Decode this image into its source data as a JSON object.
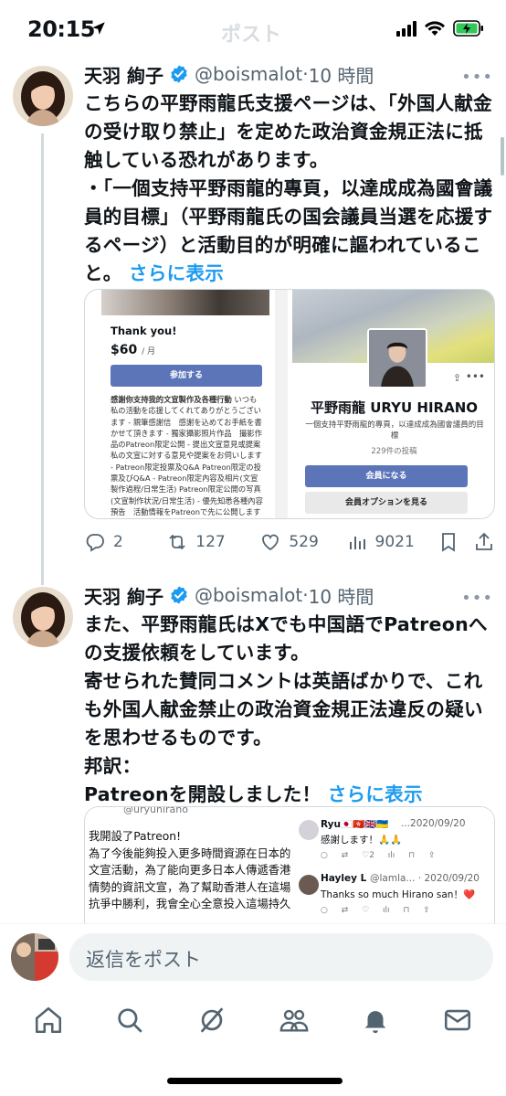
{
  "status": {
    "time": "20:15",
    "faint_title": "ポスト"
  },
  "tweets": [
    {
      "name": "天羽 絢子",
      "handle": "@boismalot",
      "dot": "·",
      "time": "10 時間",
      "text": "こちらの平野雨龍氏支援ページは、「外国人献金の受け取り禁止」を定めた政治資金規正法に抵触している恐れがあります。\n・「一個支持平野雨龍的專頁，以達成成為國會議員的目標」（平野雨龍氏の国会議員当選を応援するページ）と活動目的が明確に謳われていること。",
      "show_more": "さらに表示",
      "actions": {
        "replies": "2",
        "reposts": "127",
        "likes": "529",
        "views": "9021"
      }
    },
    {
      "name": "天羽 絢子",
      "handle": "@boismalot",
      "dot": "·",
      "time": "10 時間",
      "text": "また、平野雨龍氏はXでも中国語でPatreonへの支援依頼をしています。\n寄せられた賛同コメントは英語ばかりで、これも外国人献金禁止の政治資金規正法違反の疑いを思わせるものです。\n邦訳：\nPatreonを開設しました！",
      "show_more": "さらに表示"
    }
  ],
  "media1": {
    "left": {
      "thank_you": "Thank you!",
      "price": "$60",
      "per": "/ 月",
      "join": "参加する",
      "desc_bold": "感謝你支持我的文宣製作及各種行動",
      "desc": " いつも私の活動を応援してくれてありがとうございます - 親筆感謝信　感謝を込めてお手紙を書かせて頂きます - 獨家攝影照片作品　撮影作品のPatreon限定公開 - 提出文宣意見或提案　私の文宣に対する意見や提案をお伺いします - Patreon限定投票及Q&A Patreon限定の投票及びQ&A - Patreon限定內容及相片(文宣製作過程/日常生活) Patreon限定公開の写真 (文宣制作状況/日常生活) - 優先知悉各種內容預告　活動情報をPatreonで先に公開します"
    },
    "right": {
      "title": "平野雨龍 URYU HIRANO",
      "desc": "一個支持平野雨龍的專頁，以達成成為國會議員的目標",
      "posts": "229件の投稿",
      "member_btn": "会員になる",
      "options_btn": "会員オプションを見る"
    }
  },
  "media2": {
    "handle_top": "@uryuhirano",
    "post_text": "我開設了Patreon!\n為了今後能夠投入更多時間資源在日本的文宣活動，為了能向更多日本人傳遞香港情勢的資訊文宣，為了幫助香港人在這場抗爭中勝利，我會全心全意投入這場持久",
    "replies": [
      {
        "name": "Ryu🇯🇵🇭🇰🇬🇧🇺🇦",
        "meta": "...2020/09/20",
        "text": "感謝します！🙏🙏",
        "likes": "2"
      },
      {
        "name": "Hayley L",
        "meta": "@lamla... · 2020/09/20",
        "text": "Thanks so much Hirano san！❤️",
        "likes": ""
      }
    ]
  },
  "reply_bar": {
    "placeholder": "返信をポスト"
  },
  "nav": {
    "items": [
      "home-icon",
      "search-icon",
      "grok-icon",
      "communities-icon",
      "notifications-icon",
      "messages-icon"
    ]
  },
  "colors": {
    "accent": "#1d9bf0",
    "verified": "#1d9bf0",
    "muted": "#536471",
    "button_blue": "#5b75b8"
  }
}
